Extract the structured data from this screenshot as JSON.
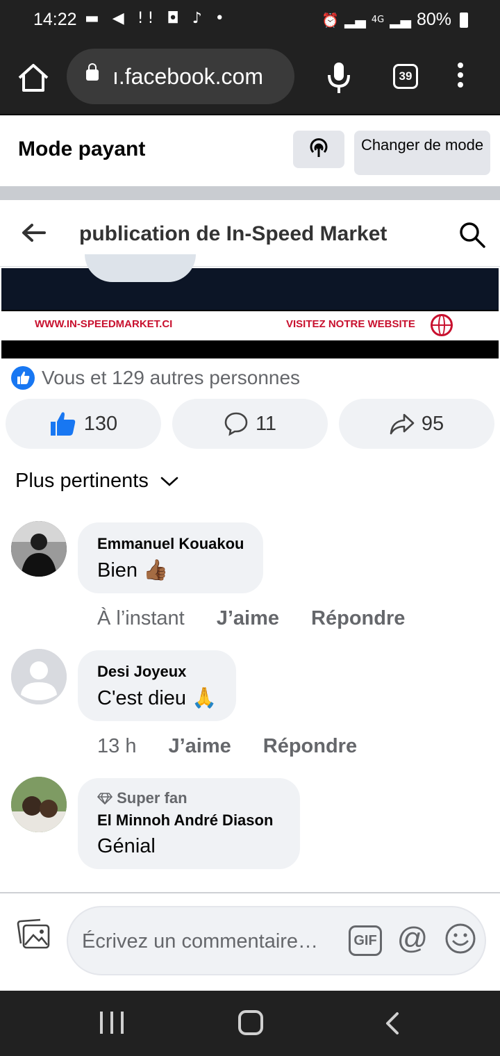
{
  "status_bar": {
    "time": "14:22",
    "notif_icons": "▬ ◀ !! ◘ ♪ •",
    "battery": "80%",
    "network": "4G"
  },
  "browser": {
    "url": "ı.facebook.com",
    "tab_count": "39"
  },
  "mode_bar": {
    "title": "Mode payant",
    "change_button": "Changer de mode"
  },
  "post_header": {
    "title": "publication de In-Speed Market"
  },
  "ad": {
    "website": "WWW.IN-SPEEDMARKET.CI",
    "cta": "VISITEZ NOTRE WEBSITE"
  },
  "reactions": {
    "summary": "Vous et 129 autres personnes",
    "like_count": "130",
    "comment_count": "11",
    "share_count": "95"
  },
  "sort": {
    "label": "Plus pertinents"
  },
  "comments": [
    {
      "author": "Emmanuel Kouakou",
      "text": "Bien 👍🏾",
      "time": "À l’instant",
      "like_label": "J’aime",
      "reply_label": "Répondre"
    },
    {
      "author": "Desi Joyeux",
      "text": "C'est dieu 🙏",
      "time": "13 h",
      "like_label": "J’aime",
      "reply_label": "Répondre"
    },
    {
      "badge": "Super fan",
      "author": "El Minnoh André Diason",
      "text": "Génial"
    }
  ],
  "composer": {
    "placeholder": "Écrivez un commentaire…",
    "gif_label": "GIF",
    "at_label": "@"
  },
  "colors": {
    "facebook_blue": "#1877f2",
    "ad_red": "#c8102e",
    "bubble_grey": "#f0f2f5",
    "secondary_text": "#65676b"
  }
}
